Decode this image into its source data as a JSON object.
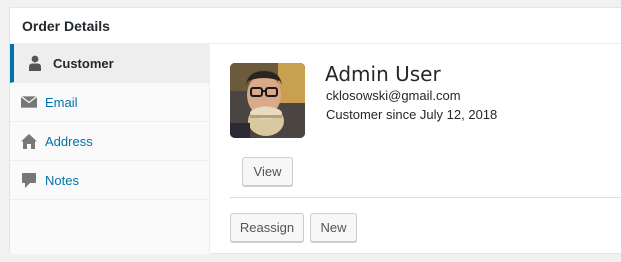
{
  "panel": {
    "title": "Order Details"
  },
  "tabs": [
    {
      "label": "Customer",
      "icon": "user-icon",
      "active": true
    },
    {
      "label": "Email",
      "icon": "envelope-icon",
      "active": false
    },
    {
      "label": "Address",
      "icon": "home-icon",
      "active": false
    },
    {
      "label": "Notes",
      "icon": "comment-icon",
      "active": false
    }
  ],
  "customer": {
    "name": "Admin User",
    "email": "cklosowski@gmail.com",
    "since": "Customer since July 12, 2018",
    "view_label": "View",
    "reassign_label": "Reassign",
    "new_label": "New"
  },
  "colors": {
    "accent": "#0073aa",
    "active_tab_bg": "#eeeeee",
    "tab_bg": "#fafafa"
  }
}
